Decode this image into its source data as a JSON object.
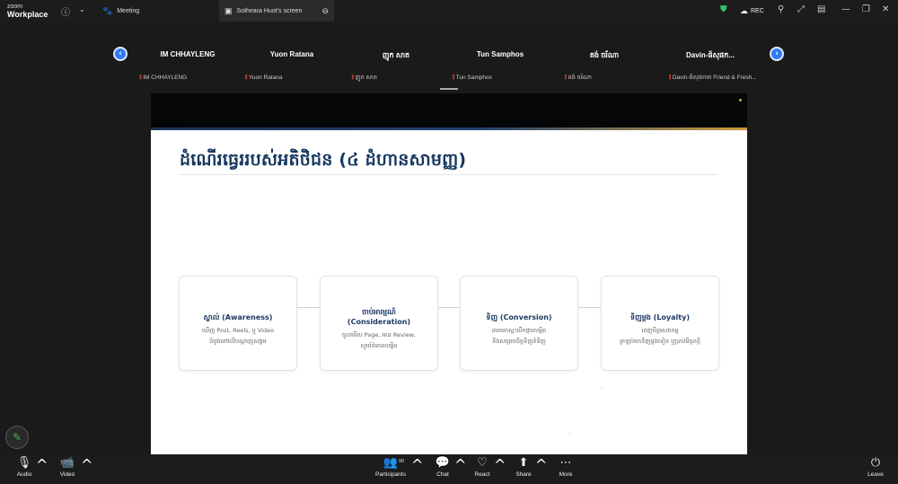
{
  "app": {
    "brand_small": "zoom",
    "brand_big": "Workplace"
  },
  "tabs": [
    {
      "label": "Meeting"
    },
    {
      "label": "Sotheara Huot's screen"
    }
  ],
  "titlebar": {
    "rec_label": "REC"
  },
  "participants": [
    {
      "name": "IM CHHAYLENG",
      "tile_label": "IM CHHAYLENG"
    },
    {
      "name": "Yuon Ratana",
      "tile_label": "Yuon Ratana"
    },
    {
      "name": "ញូក សាត",
      "tile_label": "ញូក សាត"
    },
    {
      "name": "Tun Samphos",
      "tile_label": "Tun Samphos"
    },
    {
      "name": "គង់ ចរ័ណា",
      "tile_label": "គង់ ចរ័ណា"
    },
    {
      "name": "Davin-ផ៍សុផក...",
      "tile_label": "Davin-ផ៍សុផការា Friend & Fresh..."
    }
  ],
  "slide": {
    "title": "ដំណើរធ្វេររបស់អតិថិជន (៤ ដំហានសាមញ្ញ)",
    "cards": [
      {
        "title": "ស្គាល់ (Awareness)",
        "line1": "ឃើញ Post, Reels, ឬ Video",
        "line2": "ដំបូងនៅលើបណ្តាញសង្គម"
      },
      {
        "title": "ចាប់អារម្មណ៍",
        "title2": "(Consideration)",
        "line1": "ចូលមើល Page, អាន Review,",
        "line2": "សួរព័ត៌មានលម្អិត"
      },
      {
        "title": "ទិញ (Conversion)",
        "line1": "ធាតមកស្វះបើកផ្ការលម្អិត",
        "line2": "និងសម្រេចចិត្តទិញទំនិញ"
      },
      {
        "title": "ទិញម្តង (Loyalty)",
        "line1": "ពេញចិត្តសេវាកម្ម",
        "line2": "ត្រឡប់មកទិញម្ដងទៀត ឬប្រាប់មិត្តភក្តិ"
      }
    ]
  },
  "toolbar": {
    "audio": "Audio",
    "video": "Video",
    "participants": "Participants",
    "participants_count": "90",
    "chat": "Chat",
    "react": "React",
    "share": "Share",
    "more": "More",
    "leave": "Leave"
  },
  "colors": {
    "accent_blue": "#2e7cf6",
    "slide_title": "#17385f",
    "mic_muted": "#e5483a",
    "gold": "#c79a3a"
  }
}
